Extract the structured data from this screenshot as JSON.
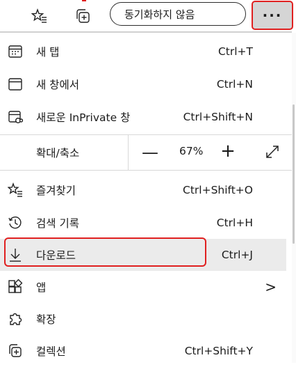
{
  "toolbar": {
    "sync_status_label": "동기화하지 않음",
    "more_label": "···"
  },
  "menu": {
    "new_tab": {
      "label": "새 탭",
      "shortcut": "Ctrl+T"
    },
    "new_window": {
      "label": "새 창에서",
      "shortcut": "Ctrl+N"
    },
    "new_inprivate": {
      "label": "새로운 InPrivate 창",
      "shortcut": "Ctrl+Shift+N"
    },
    "zoom": {
      "label": "확대/축소",
      "minus": "—",
      "value": "67%",
      "plus": "+"
    },
    "favorites": {
      "label": "즐겨찾기",
      "shortcut": "Ctrl+Shift+O"
    },
    "history": {
      "label": "검색 기록",
      "shortcut": "Ctrl+H"
    },
    "downloads": {
      "label": "다운로드",
      "shortcut": "Ctrl+J"
    },
    "apps": {
      "label": "앱",
      "chevron": ">"
    },
    "extensions": {
      "label": "확장"
    },
    "collections": {
      "label": "컬렉션",
      "shortcut": "Ctrl+Shift+Y"
    }
  }
}
